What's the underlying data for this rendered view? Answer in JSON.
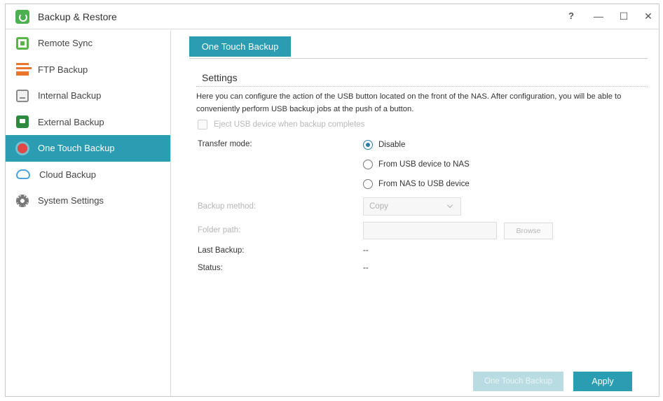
{
  "window": {
    "title": "Backup & Restore",
    "controls": {
      "help": "?",
      "minimize": "—",
      "maximize": "☐",
      "close": "✕"
    }
  },
  "sidebar": {
    "items": [
      {
        "label": "Remote Sync",
        "icon": "remote-sync-icon",
        "active": false
      },
      {
        "label": "FTP Backup",
        "icon": "ftp-icon",
        "active": false
      },
      {
        "label": "Internal Backup",
        "icon": "internal-backup-icon",
        "active": false
      },
      {
        "label": "External Backup",
        "icon": "external-backup-icon",
        "active": false
      },
      {
        "label": "One Touch Backup",
        "icon": "one-touch-icon",
        "active": true
      },
      {
        "label": "Cloud Backup",
        "icon": "cloud-icon",
        "active": false
      },
      {
        "label": "System Settings",
        "icon": "gear-icon",
        "active": false
      }
    ]
  },
  "main": {
    "tab_label": "One Touch Backup",
    "section_title": "Settings",
    "description": "Here you can configure the action of the USB button located on the front of the NAS. After configuration, you will be able to conveniently perform USB backup jobs at the push of a button.",
    "eject_checkbox_label": "Eject USB device when backup completes",
    "transfer_mode_label": "Transfer mode:",
    "transfer_modes": [
      {
        "label": "Disable",
        "checked": true
      },
      {
        "label": "From USB device to NAS",
        "checked": false
      },
      {
        "label": "From NAS to USB device",
        "checked": false
      }
    ],
    "backup_method_label": "Backup method:",
    "backup_method_value": "Copy",
    "folder_path_label": "Folder path:",
    "folder_path_value": "",
    "browse_label": "Browse",
    "last_backup_label": "Last Backup:",
    "last_backup_value": "--",
    "status_label": "Status:",
    "status_value": "--"
  },
  "footer": {
    "one_touch_button": "One Touch Backup",
    "apply_button": "Apply"
  },
  "colors": {
    "accent": "#2a9db3",
    "radio_checked": "#2a7fa8",
    "disabled_button": "#b9dce3"
  }
}
